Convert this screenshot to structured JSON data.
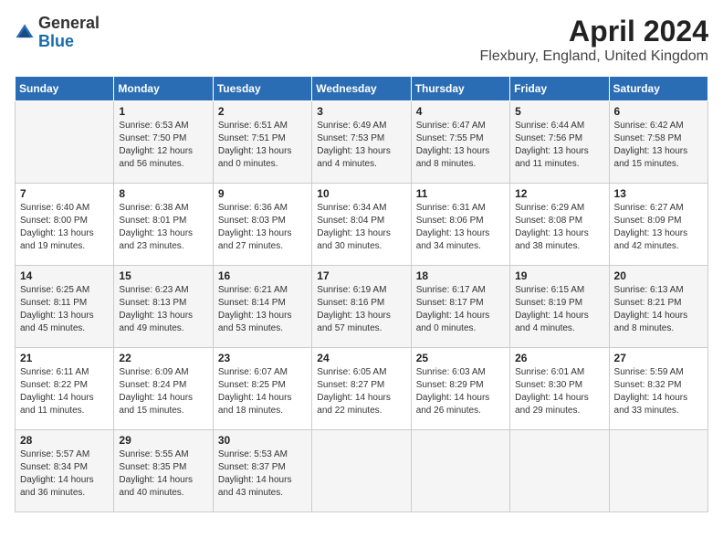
{
  "logo": {
    "general": "General",
    "blue": "Blue"
  },
  "title": {
    "month_year": "April 2024",
    "location": "Flexbury, England, United Kingdom"
  },
  "days_of_week": [
    "Sunday",
    "Monday",
    "Tuesday",
    "Wednesday",
    "Thursday",
    "Friday",
    "Saturday"
  ],
  "weeks": [
    [
      {
        "day": "",
        "sunrise": "",
        "sunset": "",
        "daylight": ""
      },
      {
        "day": "1",
        "sunrise": "Sunrise: 6:53 AM",
        "sunset": "Sunset: 7:50 PM",
        "daylight": "Daylight: 12 hours and 56 minutes."
      },
      {
        "day": "2",
        "sunrise": "Sunrise: 6:51 AM",
        "sunset": "Sunset: 7:51 PM",
        "daylight": "Daylight: 13 hours and 0 minutes."
      },
      {
        "day": "3",
        "sunrise": "Sunrise: 6:49 AM",
        "sunset": "Sunset: 7:53 PM",
        "daylight": "Daylight: 13 hours and 4 minutes."
      },
      {
        "day": "4",
        "sunrise": "Sunrise: 6:47 AM",
        "sunset": "Sunset: 7:55 PM",
        "daylight": "Daylight: 13 hours and 8 minutes."
      },
      {
        "day": "5",
        "sunrise": "Sunrise: 6:44 AM",
        "sunset": "Sunset: 7:56 PM",
        "daylight": "Daylight: 13 hours and 11 minutes."
      },
      {
        "day": "6",
        "sunrise": "Sunrise: 6:42 AM",
        "sunset": "Sunset: 7:58 PM",
        "daylight": "Daylight: 13 hours and 15 minutes."
      }
    ],
    [
      {
        "day": "7",
        "sunrise": "Sunrise: 6:40 AM",
        "sunset": "Sunset: 8:00 PM",
        "daylight": "Daylight: 13 hours and 19 minutes."
      },
      {
        "day": "8",
        "sunrise": "Sunrise: 6:38 AM",
        "sunset": "Sunset: 8:01 PM",
        "daylight": "Daylight: 13 hours and 23 minutes."
      },
      {
        "day": "9",
        "sunrise": "Sunrise: 6:36 AM",
        "sunset": "Sunset: 8:03 PM",
        "daylight": "Daylight: 13 hours and 27 minutes."
      },
      {
        "day": "10",
        "sunrise": "Sunrise: 6:34 AM",
        "sunset": "Sunset: 8:04 PM",
        "daylight": "Daylight: 13 hours and 30 minutes."
      },
      {
        "day": "11",
        "sunrise": "Sunrise: 6:31 AM",
        "sunset": "Sunset: 8:06 PM",
        "daylight": "Daylight: 13 hours and 34 minutes."
      },
      {
        "day": "12",
        "sunrise": "Sunrise: 6:29 AM",
        "sunset": "Sunset: 8:08 PM",
        "daylight": "Daylight: 13 hours and 38 minutes."
      },
      {
        "day": "13",
        "sunrise": "Sunrise: 6:27 AM",
        "sunset": "Sunset: 8:09 PM",
        "daylight": "Daylight: 13 hours and 42 minutes."
      }
    ],
    [
      {
        "day": "14",
        "sunrise": "Sunrise: 6:25 AM",
        "sunset": "Sunset: 8:11 PM",
        "daylight": "Daylight: 13 hours and 45 minutes."
      },
      {
        "day": "15",
        "sunrise": "Sunrise: 6:23 AM",
        "sunset": "Sunset: 8:13 PM",
        "daylight": "Daylight: 13 hours and 49 minutes."
      },
      {
        "day": "16",
        "sunrise": "Sunrise: 6:21 AM",
        "sunset": "Sunset: 8:14 PM",
        "daylight": "Daylight: 13 hours and 53 minutes."
      },
      {
        "day": "17",
        "sunrise": "Sunrise: 6:19 AM",
        "sunset": "Sunset: 8:16 PM",
        "daylight": "Daylight: 13 hours and 57 minutes."
      },
      {
        "day": "18",
        "sunrise": "Sunrise: 6:17 AM",
        "sunset": "Sunset: 8:17 PM",
        "daylight": "Daylight: 14 hours and 0 minutes."
      },
      {
        "day": "19",
        "sunrise": "Sunrise: 6:15 AM",
        "sunset": "Sunset: 8:19 PM",
        "daylight": "Daylight: 14 hours and 4 minutes."
      },
      {
        "day": "20",
        "sunrise": "Sunrise: 6:13 AM",
        "sunset": "Sunset: 8:21 PM",
        "daylight": "Daylight: 14 hours and 8 minutes."
      }
    ],
    [
      {
        "day": "21",
        "sunrise": "Sunrise: 6:11 AM",
        "sunset": "Sunset: 8:22 PM",
        "daylight": "Daylight: 14 hours and 11 minutes."
      },
      {
        "day": "22",
        "sunrise": "Sunrise: 6:09 AM",
        "sunset": "Sunset: 8:24 PM",
        "daylight": "Daylight: 14 hours and 15 minutes."
      },
      {
        "day": "23",
        "sunrise": "Sunrise: 6:07 AM",
        "sunset": "Sunset: 8:25 PM",
        "daylight": "Daylight: 14 hours and 18 minutes."
      },
      {
        "day": "24",
        "sunrise": "Sunrise: 6:05 AM",
        "sunset": "Sunset: 8:27 PM",
        "daylight": "Daylight: 14 hours and 22 minutes."
      },
      {
        "day": "25",
        "sunrise": "Sunrise: 6:03 AM",
        "sunset": "Sunset: 8:29 PM",
        "daylight": "Daylight: 14 hours and 26 minutes."
      },
      {
        "day": "26",
        "sunrise": "Sunrise: 6:01 AM",
        "sunset": "Sunset: 8:30 PM",
        "daylight": "Daylight: 14 hours and 29 minutes."
      },
      {
        "day": "27",
        "sunrise": "Sunrise: 5:59 AM",
        "sunset": "Sunset: 8:32 PM",
        "daylight": "Daylight: 14 hours and 33 minutes."
      }
    ],
    [
      {
        "day": "28",
        "sunrise": "Sunrise: 5:57 AM",
        "sunset": "Sunset: 8:34 PM",
        "daylight": "Daylight: 14 hours and 36 minutes."
      },
      {
        "day": "29",
        "sunrise": "Sunrise: 5:55 AM",
        "sunset": "Sunset: 8:35 PM",
        "daylight": "Daylight: 14 hours and 40 minutes."
      },
      {
        "day": "30",
        "sunrise": "Sunrise: 5:53 AM",
        "sunset": "Sunset: 8:37 PM",
        "daylight": "Daylight: 14 hours and 43 minutes."
      },
      {
        "day": "",
        "sunrise": "",
        "sunset": "",
        "daylight": ""
      },
      {
        "day": "",
        "sunrise": "",
        "sunset": "",
        "daylight": ""
      },
      {
        "day": "",
        "sunrise": "",
        "sunset": "",
        "daylight": ""
      },
      {
        "day": "",
        "sunrise": "",
        "sunset": "",
        "daylight": ""
      }
    ]
  ]
}
